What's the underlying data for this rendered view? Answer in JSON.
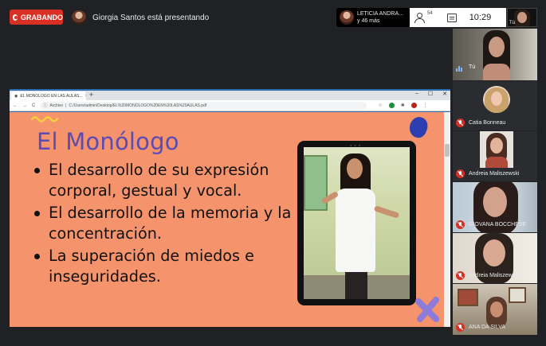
{
  "meet": {
    "recording_label": "GRABANDO",
    "presenter_text": "Giorgia Santos está presentando",
    "pinned_presenter": {
      "line1": "LETICIA ANDRA...",
      "line2": "y 46 más"
    },
    "participants_count": "54",
    "time": "10:29",
    "self_label": "Tú"
  },
  "browser": {
    "tab_title": "EL MONOLOGO EN LAS AULAS...",
    "tab_close": "×",
    "new_tab": "+",
    "window_buttons": [
      "–",
      "☐",
      "✕"
    ],
    "nav": {
      "back": "←",
      "forward": "→",
      "reload": "C"
    },
    "url_prefix": "Archivo",
    "url": "C:/Users/admin/Desktop/EL%20MONOLOGO%20EN%20LAS%20AULAS.pdf"
  },
  "slide": {
    "title": "El Monólogo",
    "bullets": [
      "El desarrollo de su expresión corporal, gestual y vocal.",
      "El desarrollo de la memoria y la concentración.",
      "La superación de miedos e inseguridades."
    ],
    "colors": {
      "background": "#f5946c",
      "title": "#5b4bb3",
      "accent_blue": "#2d3fb0",
      "accent_purple": "#8e7bd9",
      "accent_yellow": "#f4d43a"
    }
  },
  "sidebar": {
    "self_name": "Tú",
    "participants": [
      {
        "name": "Catia Bonneau"
      },
      {
        "name": "Andreia Maliszewski"
      },
      {
        "name": "GIOVANA BOCCHESE"
      },
      {
        "name": "Andreia Maliszewski"
      },
      {
        "name": "ANA DA SILVA"
      }
    ]
  }
}
